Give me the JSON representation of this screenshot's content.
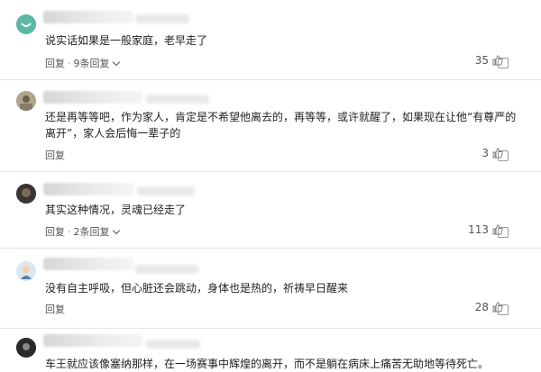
{
  "comments": [
    {
      "text_lines": [
        "说实话如果是一般家庭，老早走了"
      ],
      "reply_label": "回复",
      "replies_label": "9条回复",
      "likes": "35"
    },
    {
      "text_lines": [
        "还是再等等吧，作为家人，肯定是不希望他离去的，再等等，或许就醒了，如果现在让他“有尊严的",
        "离开”，家人会后悔一辈子的"
      ],
      "reply_label": "回复",
      "replies_label": "",
      "likes": "3"
    },
    {
      "text_lines": [
        "其实这种情况，灵魂已经走了"
      ],
      "reply_label": "回复",
      "replies_label": "2条回复",
      "likes": "113"
    },
    {
      "text_lines": [
        "没有自主呼吸，但心脏还会跳动，身体也是热的，祈祷早日醒来"
      ],
      "reply_label": "回复",
      "replies_label": "",
      "likes": "28"
    },
    {
      "text_lines": [
        "车王就应该像塞纳那样，在一场赛事中辉煌的离开，而不是躺在病床上痛苦无助地等待死亡。"
      ],
      "reply_label": "",
      "replies_label": "",
      "likes": ""
    }
  ],
  "separator": "·",
  "icons": {
    "like": "thumbs-up-icon",
    "more": "more-icon",
    "chevron": "chevron-down-icon"
  },
  "colors": {
    "text": "#222222",
    "muted": "#555555",
    "divider": "#e6e6e6"
  }
}
